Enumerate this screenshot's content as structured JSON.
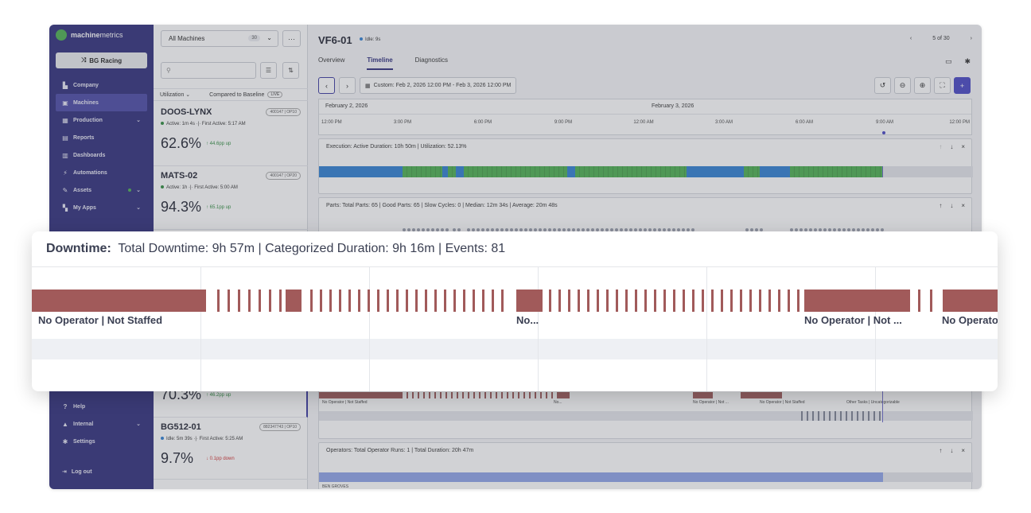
{
  "sidebar": {
    "logo_pre": "machine",
    "logo_post": "metrics",
    "org_button": "BG Racing",
    "items": [
      {
        "label": "Company",
        "icon": "chart-icon",
        "glyph": "▙"
      },
      {
        "label": "Machines",
        "icon": "machine-icon",
        "glyph": "▣",
        "active": true
      },
      {
        "label": "Production",
        "icon": "calendar-icon",
        "glyph": "▦",
        "chevron": "⌄"
      },
      {
        "label": "Reports",
        "icon": "document-icon",
        "glyph": "▤"
      },
      {
        "label": "Dashboards",
        "icon": "bar-chart-icon",
        "glyph": "▥"
      },
      {
        "label": "Automations",
        "icon": "bolt-icon",
        "glyph": "⚡"
      },
      {
        "label": "Assets",
        "icon": "wrench-icon",
        "glyph": "✎",
        "chevron": "⌄",
        "dot": true
      },
      {
        "label": "My Apps",
        "icon": "apps-icon",
        "glyph": "▚",
        "chevron": "⌄"
      }
    ],
    "bottom_items": [
      {
        "label": "Help",
        "icon": "help-icon",
        "glyph": "?"
      },
      {
        "label": "Internal",
        "icon": "lock-icon",
        "glyph": "▲",
        "chevron": "⌄"
      },
      {
        "label": "Settings",
        "icon": "gear-icon",
        "glyph": "✱"
      }
    ],
    "logout": "Log out"
  },
  "list": {
    "selector": "All Machines",
    "selector_count": "30",
    "util_label": "Utilization",
    "compare_label": "Compared to Baseline",
    "live_badge": "LIVE",
    "machines": [
      {
        "name": "DOOS-LYNX",
        "tag": "400147 | OP10",
        "status": "Active: 1m 4s  ·|· First Active: 5:17 AM",
        "status_color": "#2e8b3e",
        "pct": "62.6%",
        "delta": "↑ 44.6pp up",
        "dir": "up"
      },
      {
        "name": "MATS-02",
        "tag": "400147 | OP20",
        "status": "Active: 1h  ·|· First Active: 5:00 AM",
        "status_color": "#2e8b3e",
        "pct": "94.3%",
        "delta": "↑ 65.1pp up",
        "dir": "up"
      },
      {
        "name": "",
        "tag": "",
        "status": "",
        "status_color": "#2e8b3e",
        "pct": "70.3%",
        "delta": "↑ 46.2pp up",
        "dir": "up"
      },
      {
        "name": "BG512-01",
        "tag": "882347743 | OP10",
        "status": "Idle: 5m 39s  ·|· First Active: 5:25 AM",
        "status_color": "#2f7fd1",
        "pct": "9.7%",
        "delta": "↓ 0.1pp down",
        "dir": "down"
      }
    ]
  },
  "main": {
    "title": "VF6-01",
    "status": "Idle: 9s",
    "pager": "5 of 30",
    "tabs": [
      "Overview",
      "Timeline",
      "Diagnostics"
    ],
    "active_tab": 1,
    "range": "Custom: Feb 2, 2026 12:00 PM - Feb 3, 2026 12:00 PM",
    "date1": "February 2, 2026",
    "date2": "February 3, 2026",
    "ticks": [
      "12:00 PM",
      "3:00 PM",
      "6:00 PM",
      "9:00 PM",
      "12:00 AM",
      "3:00 AM",
      "6:00 AM",
      "9:00 AM",
      "12:00 PM"
    ],
    "execution_header": "Execution:  Active Duration: 10h 50m  |  Utilization: 52.13%",
    "parts_header": "Parts:  Total Parts: 65  |  Good Parts: 65  |  Slow Cycles: 0  |  Median: 12m 34s  |  Average: 20m 48s",
    "downtime_small_labels": [
      "No Operator | Not Staffed",
      "No...",
      "No Operator | Not ...",
      "No Operator | Not Staffed",
      "Other Tasks | Uncategorizable"
    ],
    "operators_header": "Operators:  Total Operator Runs: 1  |  Total Duration: 20h 47m",
    "operator_name": "BEN GROVES",
    "colors": {
      "active": "#2f7fd1",
      "green": "#4caf50",
      "downtime": "#a15a5a",
      "operator": "#8ea2e8",
      "brand": "#2f2d7a"
    }
  },
  "overlay": {
    "label_prefix": "Downtime:",
    "header": "Total Downtime: 9h 57m  |  Categorized Duration: 9h 16m  |  Events: 81",
    "labels": [
      "No Operator | Not Staffed",
      "No...",
      "No Operator | Not ...",
      "No Operato"
    ]
  }
}
